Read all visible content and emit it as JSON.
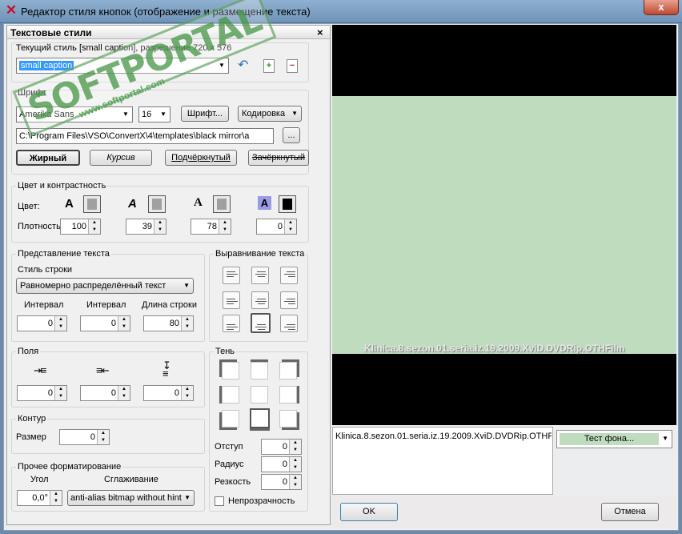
{
  "window": {
    "title": "Редактор стиля кнопок (отображение и размещение текста)",
    "close": "x"
  },
  "panel": {
    "title": "Текстовые стили",
    "close": "×"
  },
  "style": {
    "current_label": "Текущий стиль [small caption], разрешение 720 x 576",
    "value": "small caption"
  },
  "font": {
    "group_label": "Шрифт",
    "family": "Amerika Sans",
    "size": "16",
    "font_button": "Шрифт...",
    "encoding": "Кодировка",
    "path": "C:\\Program Files\\VSO\\ConvertX\\4\\templates\\black mirror\\a",
    "browse": "...",
    "bold": "Жирный",
    "italic": "Курсив",
    "underline": "Подчёркнутый",
    "strike": "Зачёркнутый"
  },
  "color": {
    "group_label": "Цвет и контрастность",
    "color_label": "Цвет:",
    "opacity_label": "Плотность",
    "opacities": [
      "100",
      "39",
      "78",
      "0"
    ]
  },
  "text_layout": {
    "group_label": "Представление текста",
    "line_style_label": "Стиль строки",
    "line_style": "Равномерно распределённый текст",
    "interval1_label": "Интервал",
    "interval2_label": "Интервал",
    "line_length_label": "Длина строки",
    "interval1": "0",
    "interval2": "0",
    "line_length": "80"
  },
  "align": {
    "group_label": "Выравнивание текста"
  },
  "margins": {
    "group_label": "Поля",
    "values": [
      "0",
      "0",
      "0"
    ]
  },
  "contour": {
    "group_label": "Контур",
    "size_label": "Размер",
    "size": "0"
  },
  "shadow": {
    "group_label": "Тень",
    "offset_label": "Отступ",
    "offset": "0",
    "radius_label": "Радиус",
    "radius": "0",
    "sharp_label": "Резкость",
    "sharp": "0",
    "opaque_label": "Непрозрачность"
  },
  "other": {
    "group_label": "Прочее форматирование",
    "angle_label": "Угол",
    "smooth_label": "Сглаживание",
    "angle": "0,0°",
    "smooth": "anti-alias bitmap without hint"
  },
  "preview": {
    "caption": "Klinica.8.sezon.01.seria.iz.19.2009.XviD.DVDRip.OTHFilm",
    "text": "Klinica.8.sezon.01.seria.iz.19.2009.XviD.DVDRip.OTHFilm",
    "bg_test": "Тест фона..."
  },
  "buttons": {
    "ok": "OK",
    "cancel": "Отмена"
  },
  "watermark": {
    "logo": "SOFTPORTAL",
    "url": "www.softportal.com",
    "tm": "TM"
  }
}
